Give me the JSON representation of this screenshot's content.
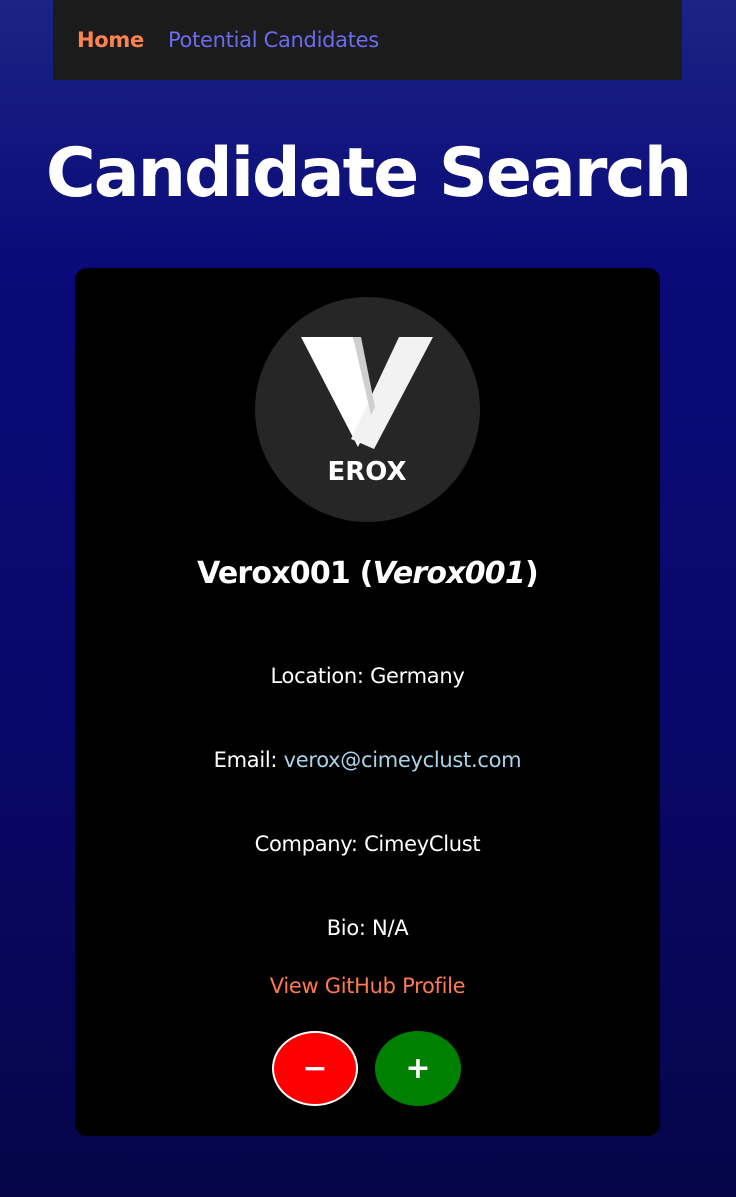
{
  "nav": {
    "home_label": "Home",
    "candidates_label": "Potential Candidates"
  },
  "page": {
    "title": "Candidate Search"
  },
  "candidate": {
    "avatar_text": "EROX",
    "name": "Verox001",
    "login": "Verox001",
    "location_label": "Location: ",
    "location": "Germany",
    "email_label": "Email: ",
    "email": "verox@cimeyclust.com",
    "company_label": "Company: ",
    "company": "CimeyClust",
    "bio_label": "Bio: ",
    "bio": "N/A",
    "github_link_label": "View GitHub Profile"
  },
  "actions": {
    "reject_label": "−",
    "accept_label": "+"
  },
  "colors": {
    "nav_home": "#ff8350",
    "nav_candidates": "#6b6bf2",
    "reject": "#ff0000",
    "accept": "#008000",
    "link": "#ff7a50",
    "email": "#a9d3e9"
  }
}
